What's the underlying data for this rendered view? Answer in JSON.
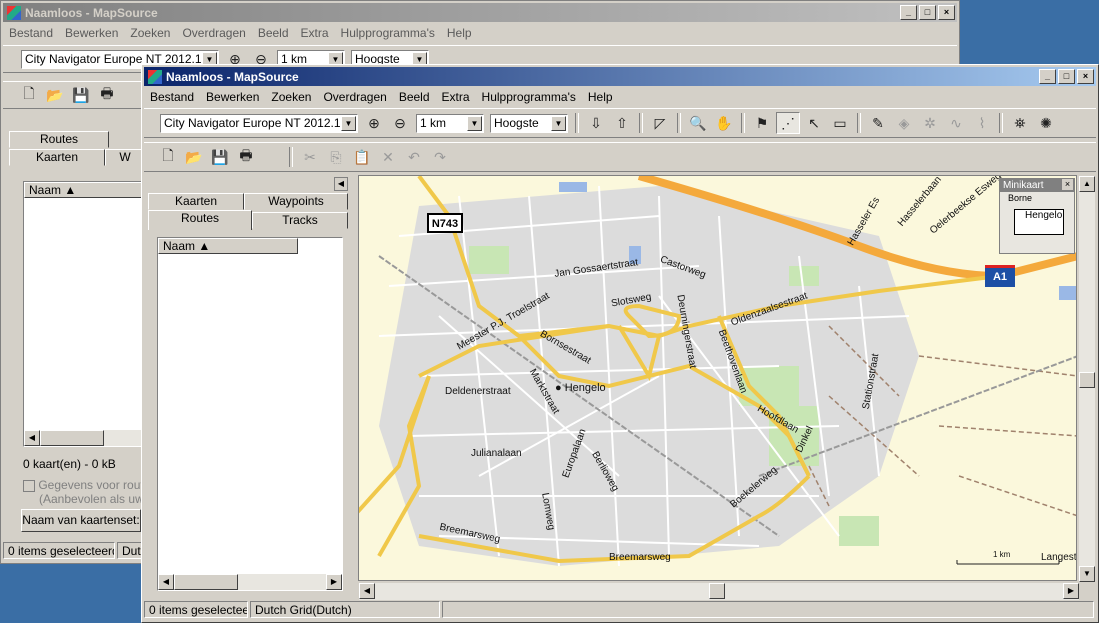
{
  "back_window": {
    "title": "Naamloos - MapSource",
    "menu": [
      "Bestand",
      "Bewerken",
      "Zoeken",
      "Overdragen",
      "Beeld",
      "Extra",
      "Hulpprogramma's",
      "Help"
    ],
    "map_select": "City Navigator Europe NT 2012.1",
    "scale_select": "1 km",
    "detail_select": "Hoogste",
    "tabs": [
      "Routes",
      "Kaarten",
      "W"
    ],
    "col_name": "Naam",
    "map_count": "0 kaart(en) - 0 kB",
    "checkbox_label": "Gegevens voor route",
    "checkbox_sub": "(Aanbevolen als uw G",
    "mapset_button": "Naam van kaartenset:",
    "status": [
      "0 items geselecteerd",
      "Dut"
    ]
  },
  "front_window": {
    "title": "Naamloos - MapSource",
    "menu": [
      "Bestand",
      "Bewerken",
      "Zoeken",
      "Overdragen",
      "Beeld",
      "Extra",
      "Hulpprogramma's",
      "Help"
    ],
    "map_select": "City Navigator Europe NT 2012.1",
    "scale_select": "1 km",
    "detail_select": "Hoogste",
    "tabs": {
      "kaarten": "Kaarten",
      "waypoints": "Waypoints",
      "routes": "Routes",
      "tracks": "Tracks"
    },
    "col_name": "Naam",
    "status": [
      "0 items geselecteerd",
      "Dutch Grid(Dutch)"
    ]
  },
  "map": {
    "minikaart_title": "Minikaart",
    "minikaart_city": "Hengelo",
    "minikaart_top": "Borne",
    "city_label": "Hengelo",
    "scale_label": "1 km",
    "shields": {
      "n743": "N743",
      "a1": "A1"
    },
    "streets": [
      "Jan Gossaertstraat",
      "Castorweg",
      "Slotsweg",
      "Deurningerstraat",
      "Oldenzaalsestraat",
      "Meester P.J. Troelstraat",
      "Bornsestraat",
      "Deldenerstraat",
      "Marktstraat",
      "Julianalaan",
      "Europalaan",
      "Beethovenlaan",
      "Hoofdlaan",
      "Dinkel",
      "Boekelerweg",
      "Breemarsweg",
      "Breemarsweg",
      "Lomweg",
      "Stationstraat",
      "Hasseler Es",
      "Oldenzaalsestraat",
      "Langestraat",
      "Berlioweg",
      "Hasselerbaan",
      "Oelerbeekse Esweg"
    ],
    "colors": {
      "land": "#fbf8dc",
      "road_major": "#f0c84a",
      "highway": "#f4a93c",
      "park": "#c8e6b4",
      "water": "#9ab8e6",
      "urban": "#dcdcdc"
    }
  }
}
